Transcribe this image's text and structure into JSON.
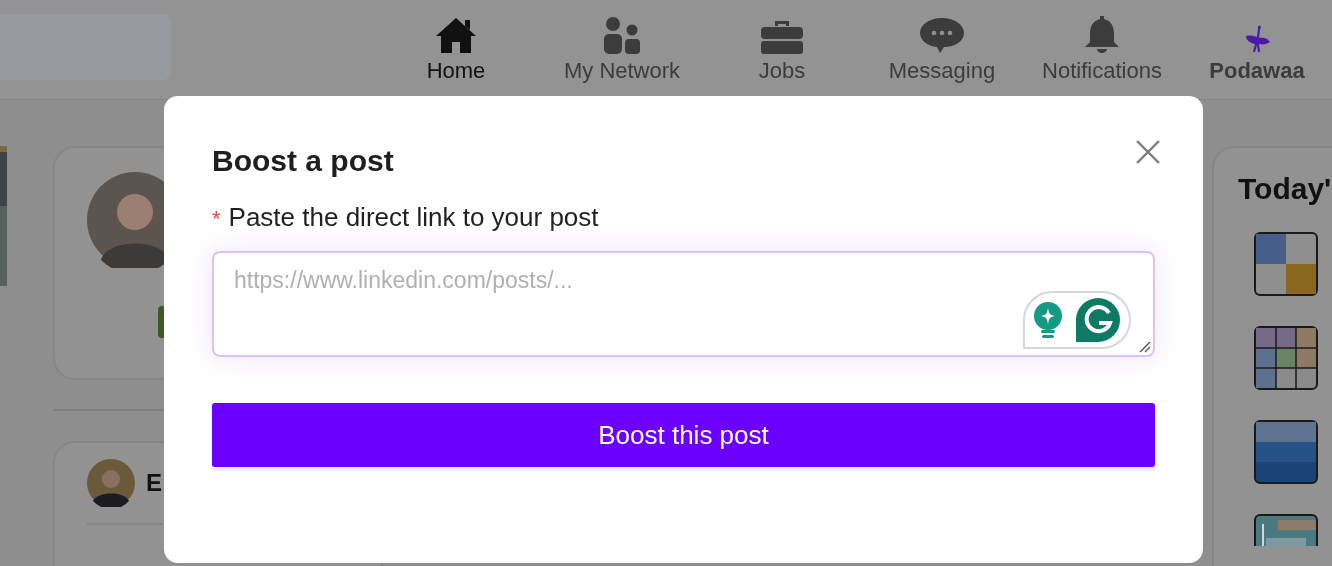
{
  "nav": {
    "items": [
      {
        "label": "Home",
        "selected": true
      },
      {
        "label": "My Network",
        "selected": false
      },
      {
        "label": "Jobs",
        "selected": false
      },
      {
        "label": "Messaging",
        "selected": false
      },
      {
        "label": "Notifications",
        "selected": false
      },
      {
        "label": "Podawaa",
        "selected": false
      }
    ]
  },
  "right_card": {
    "title": "Today'"
  },
  "feed_post": {
    "author": "E"
  },
  "modal": {
    "title": "Boost a post",
    "label": "Paste the direct link to your post",
    "required_mark": "*",
    "placeholder": "https://www.linkedin.com/posts/...",
    "button": "Boost this post"
  }
}
